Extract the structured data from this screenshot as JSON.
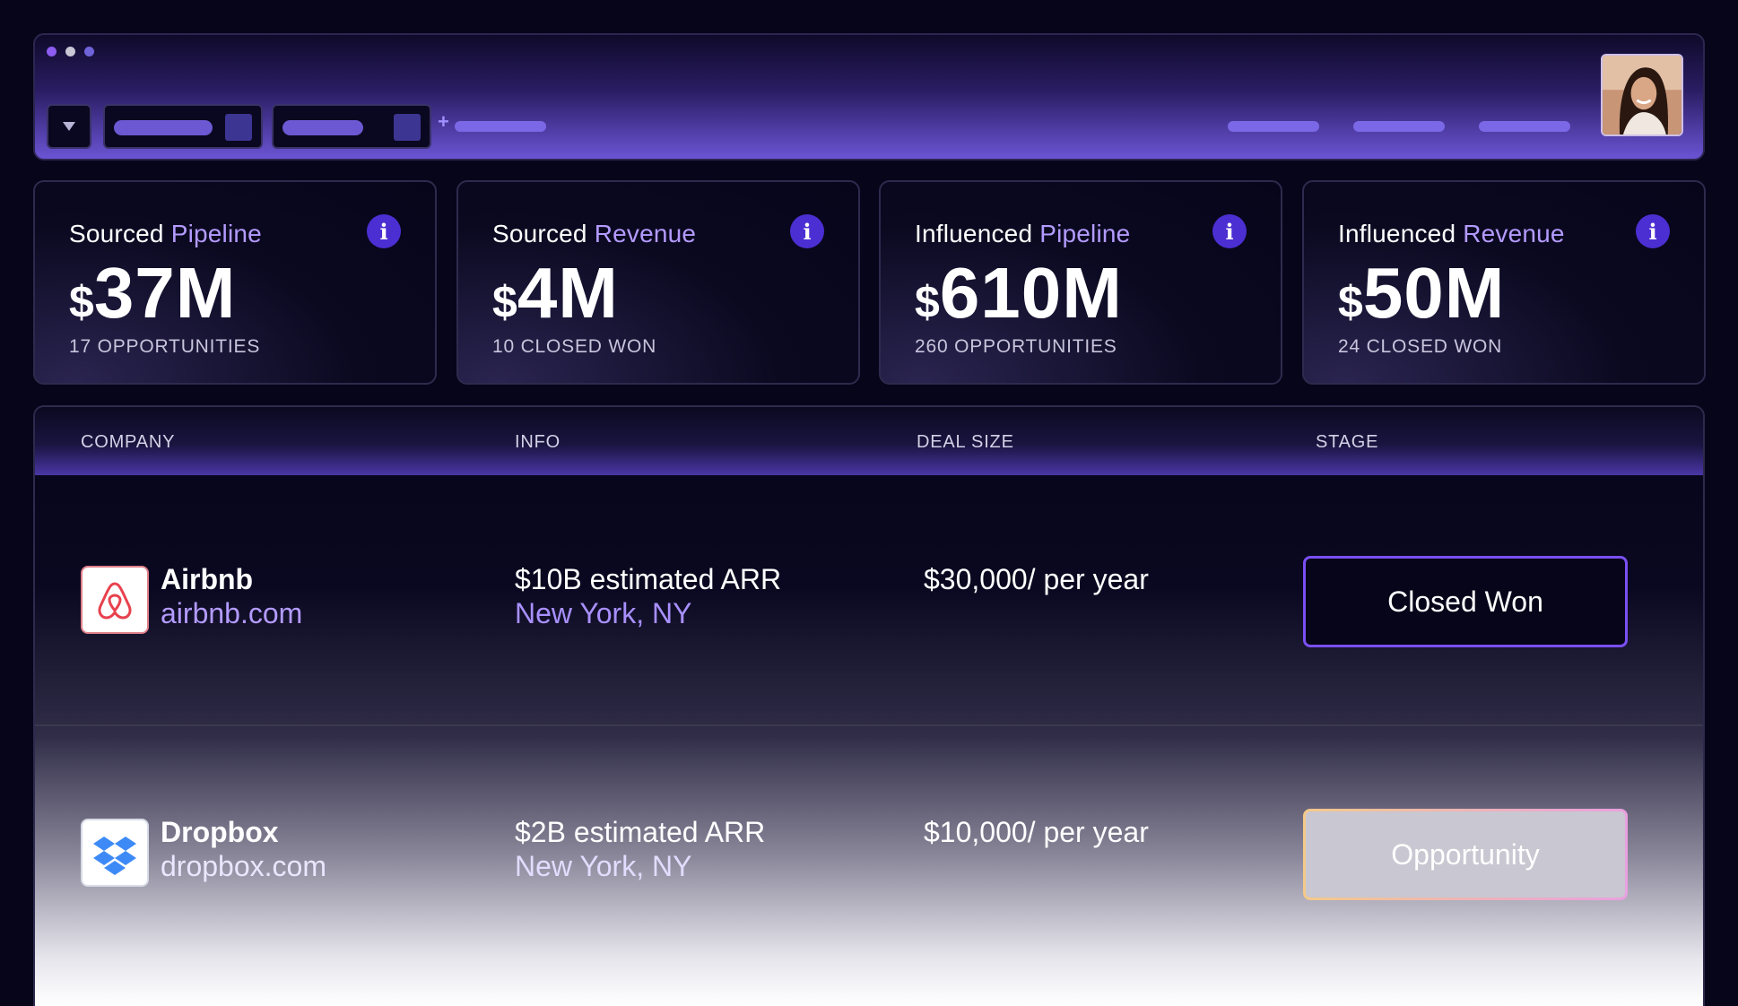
{
  "window": {
    "dots": [
      "purple",
      "gray",
      "violet"
    ]
  },
  "toolbar": {
    "filter_icon": "triangle-down-icon",
    "add_symbol": "+"
  },
  "stats": [
    {
      "title_1": "Sourced",
      "title_2": "Pipeline",
      "currency": "$",
      "value": "37M",
      "sub": "17 OPPORTUNITIES"
    },
    {
      "title_1": "Sourced",
      "title_2": "Revenue",
      "currency": "$",
      "value": "4M",
      "sub": "10 CLOSED WON"
    },
    {
      "title_1": "Influenced",
      "title_2": "Pipeline",
      "currency": "$",
      "value": "610M",
      "sub": "260 OPPORTUNITIES"
    },
    {
      "title_1": "Influenced",
      "title_2": "Revenue",
      "currency": "$",
      "value": "50M",
      "sub": "24 CLOSED WON"
    }
  ],
  "info_glyph": "i",
  "table": {
    "headers": [
      "COMPANY",
      "INFO",
      "DEAL SIZE",
      "STAGE"
    ],
    "rows": [
      {
        "name": "Airbnb",
        "url": "airbnb.com",
        "info": "$10B estimated ARR",
        "location": "New York, NY",
        "deal": "$30,000/ per year",
        "stage": "Closed Won",
        "logo": "airbnb-logo"
      },
      {
        "name": "Dropbox",
        "url": "dropbox.com",
        "info": "$2B estimated ARR",
        "location": "New York, NY",
        "deal": "$10,000/ per year",
        "stage": "Opportunity",
        "logo": "dropbox-logo"
      }
    ]
  },
  "colors": {
    "accent": "#b39bff",
    "info_badge": "#4b2fd2",
    "closed_won_border": "#7a4ff2",
    "opportunity_border_start": "#f4c98a",
    "opportunity_border_end": "#e9a0e0"
  }
}
